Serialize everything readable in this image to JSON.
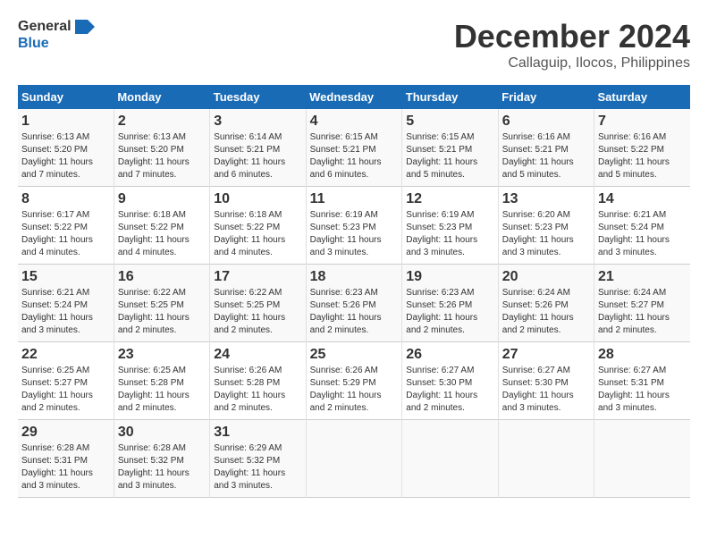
{
  "logo": {
    "line1": "General",
    "line2": "Blue"
  },
  "title": "December 2024",
  "subtitle": "Callaguip, Ilocos, Philippines",
  "days_of_week": [
    "Sunday",
    "Monday",
    "Tuesday",
    "Wednesday",
    "Thursday",
    "Friday",
    "Saturday"
  ],
  "weeks": [
    [
      {
        "day": "1",
        "sunrise": "6:13 AM",
        "sunset": "5:20 PM",
        "daylight": "11 hours and 7 minutes."
      },
      {
        "day": "2",
        "sunrise": "6:13 AM",
        "sunset": "5:20 PM",
        "daylight": "11 hours and 7 minutes."
      },
      {
        "day": "3",
        "sunrise": "6:14 AM",
        "sunset": "5:21 PM",
        "daylight": "11 hours and 6 minutes."
      },
      {
        "day": "4",
        "sunrise": "6:15 AM",
        "sunset": "5:21 PM",
        "daylight": "11 hours and 6 minutes."
      },
      {
        "day": "5",
        "sunrise": "6:15 AM",
        "sunset": "5:21 PM",
        "daylight": "11 hours and 5 minutes."
      },
      {
        "day": "6",
        "sunrise": "6:16 AM",
        "sunset": "5:21 PM",
        "daylight": "11 hours and 5 minutes."
      },
      {
        "day": "7",
        "sunrise": "6:16 AM",
        "sunset": "5:22 PM",
        "daylight": "11 hours and 5 minutes."
      }
    ],
    [
      {
        "day": "8",
        "sunrise": "6:17 AM",
        "sunset": "5:22 PM",
        "daylight": "11 hours and 4 minutes."
      },
      {
        "day": "9",
        "sunrise": "6:18 AM",
        "sunset": "5:22 PM",
        "daylight": "11 hours and 4 minutes."
      },
      {
        "day": "10",
        "sunrise": "6:18 AM",
        "sunset": "5:22 PM",
        "daylight": "11 hours and 4 minutes."
      },
      {
        "day": "11",
        "sunrise": "6:19 AM",
        "sunset": "5:23 PM",
        "daylight": "11 hours and 3 minutes."
      },
      {
        "day": "12",
        "sunrise": "6:19 AM",
        "sunset": "5:23 PM",
        "daylight": "11 hours and 3 minutes."
      },
      {
        "day": "13",
        "sunrise": "6:20 AM",
        "sunset": "5:23 PM",
        "daylight": "11 hours and 3 minutes."
      },
      {
        "day": "14",
        "sunrise": "6:21 AM",
        "sunset": "5:24 PM",
        "daylight": "11 hours and 3 minutes."
      }
    ],
    [
      {
        "day": "15",
        "sunrise": "6:21 AM",
        "sunset": "5:24 PM",
        "daylight": "11 hours and 3 minutes."
      },
      {
        "day": "16",
        "sunrise": "6:22 AM",
        "sunset": "5:25 PM",
        "daylight": "11 hours and 2 minutes."
      },
      {
        "day": "17",
        "sunrise": "6:22 AM",
        "sunset": "5:25 PM",
        "daylight": "11 hours and 2 minutes."
      },
      {
        "day": "18",
        "sunrise": "6:23 AM",
        "sunset": "5:26 PM",
        "daylight": "11 hours and 2 minutes."
      },
      {
        "day": "19",
        "sunrise": "6:23 AM",
        "sunset": "5:26 PM",
        "daylight": "11 hours and 2 minutes."
      },
      {
        "day": "20",
        "sunrise": "6:24 AM",
        "sunset": "5:26 PM",
        "daylight": "11 hours and 2 minutes."
      },
      {
        "day": "21",
        "sunrise": "6:24 AM",
        "sunset": "5:27 PM",
        "daylight": "11 hours and 2 minutes."
      }
    ],
    [
      {
        "day": "22",
        "sunrise": "6:25 AM",
        "sunset": "5:27 PM",
        "daylight": "11 hours and 2 minutes."
      },
      {
        "day": "23",
        "sunrise": "6:25 AM",
        "sunset": "5:28 PM",
        "daylight": "11 hours and 2 minutes."
      },
      {
        "day": "24",
        "sunrise": "6:26 AM",
        "sunset": "5:28 PM",
        "daylight": "11 hours and 2 minutes."
      },
      {
        "day": "25",
        "sunrise": "6:26 AM",
        "sunset": "5:29 PM",
        "daylight": "11 hours and 2 minutes."
      },
      {
        "day": "26",
        "sunrise": "6:27 AM",
        "sunset": "5:30 PM",
        "daylight": "11 hours and 2 minutes."
      },
      {
        "day": "27",
        "sunrise": "6:27 AM",
        "sunset": "5:30 PM",
        "daylight": "11 hours and 3 minutes."
      },
      {
        "day": "28",
        "sunrise": "6:27 AM",
        "sunset": "5:31 PM",
        "daylight": "11 hours and 3 minutes."
      }
    ],
    [
      {
        "day": "29",
        "sunrise": "6:28 AM",
        "sunset": "5:31 PM",
        "daylight": "11 hours and 3 minutes."
      },
      {
        "day": "30",
        "sunrise": "6:28 AM",
        "sunset": "5:32 PM",
        "daylight": "11 hours and 3 minutes."
      },
      {
        "day": "31",
        "sunrise": "6:29 AM",
        "sunset": "5:32 PM",
        "daylight": "11 hours and 3 minutes."
      },
      null,
      null,
      null,
      null
    ]
  ],
  "labels": {
    "sunrise": "Sunrise:",
    "sunset": "Sunset:",
    "daylight": "Daylight:"
  }
}
